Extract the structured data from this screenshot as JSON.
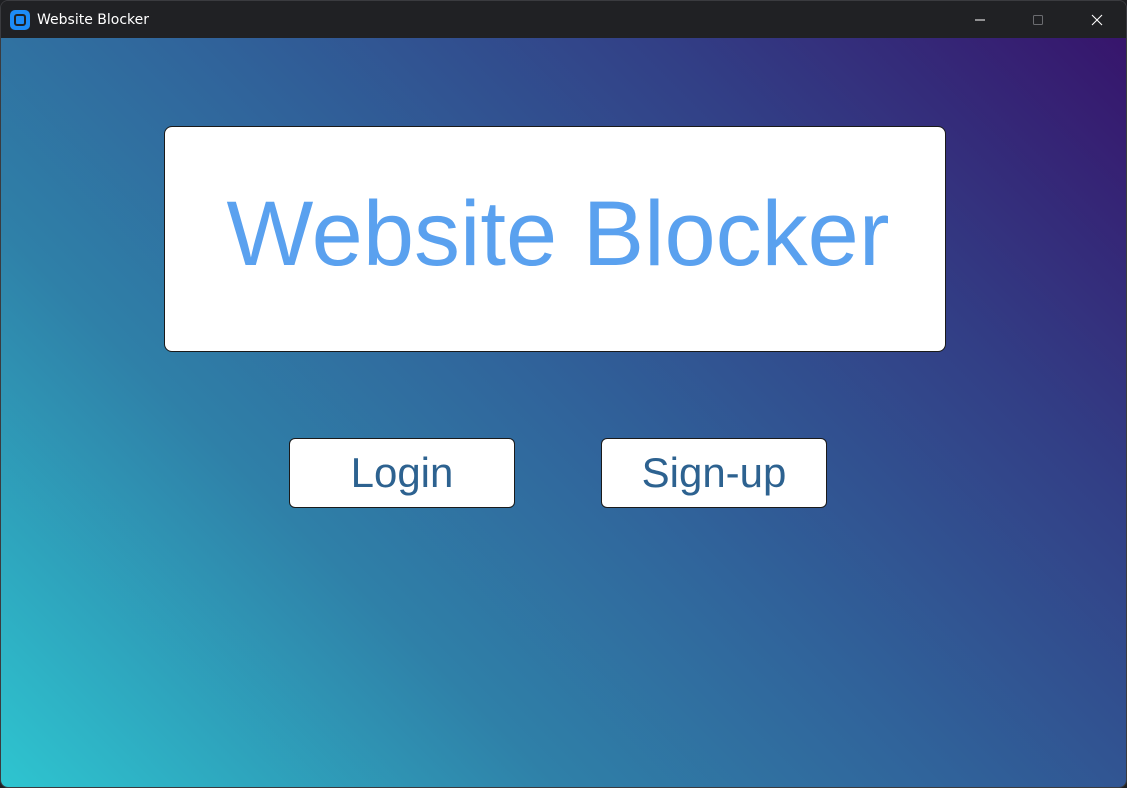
{
  "window": {
    "title": "Website Blocker",
    "app_icon": "app-icon",
    "controls": {
      "minimize_icon": "minimize-icon",
      "maximize_icon": "maximize-icon",
      "close_icon": "close-icon"
    }
  },
  "main": {
    "heading": "Website Blocker",
    "buttons": {
      "login": "Login",
      "signup": "Sign-up"
    }
  },
  "colors": {
    "heading_text": "#5aa1ef",
    "button_text": "#2d6290",
    "gradient_start": "#2ec5d0",
    "gradient_end": "#37156c",
    "titlebar": "#202124"
  }
}
